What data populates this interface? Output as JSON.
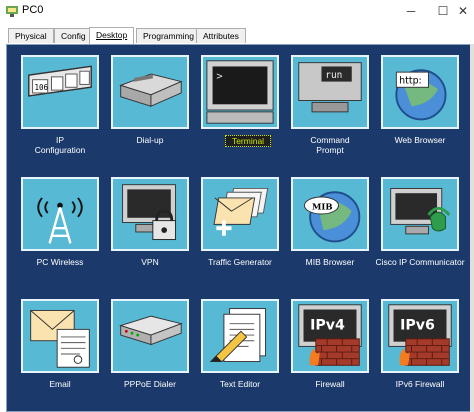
{
  "window": {
    "title": "PC0",
    "minimize": "─",
    "maximize": "☐",
    "close": "✕"
  },
  "tabs": [
    {
      "label": "Physical"
    },
    {
      "label": "Config"
    },
    {
      "label": "Desktop"
    },
    {
      "label": "Programming"
    },
    {
      "label": "Attributes"
    }
  ],
  "active_tab": "Desktop",
  "apps": [
    {
      "label": "IP\nConfiguration",
      "icon": "ip-configuration-icon",
      "badge": "106"
    },
    {
      "label": "Dial-up",
      "icon": "modem-icon"
    },
    {
      "label": "Terminal",
      "icon": "terminal-icon",
      "prompt": ">"
    },
    {
      "label": "Command\nPrompt",
      "icon": "command-prompt-icon",
      "prompt": "run"
    },
    {
      "label": "Web Browser",
      "icon": "web-browser-icon",
      "prompt": "http:"
    },
    {
      "label": "PC Wireless",
      "icon": "wireless-tower-icon"
    },
    {
      "label": "VPN",
      "icon": "vpn-lock-icon"
    },
    {
      "label": "Traffic Generator",
      "icon": "traffic-generator-icon"
    },
    {
      "label": "MIB Browser",
      "icon": "mib-browser-icon",
      "prompt": "MIB"
    },
    {
      "label": "Cisco IP Communicator",
      "icon": "ip-communicator-icon"
    },
    {
      "label": "Email",
      "icon": "email-icon"
    },
    {
      "label": "PPPoE Dialer",
      "icon": "pppoe-dialer-icon"
    },
    {
      "label": "Text Editor",
      "icon": "text-editor-icon"
    },
    {
      "label": "Firewall",
      "icon": "firewall-ipv4-icon",
      "prompt": "IPv4"
    },
    {
      "label": "IPv6 Firewall",
      "icon": "firewall-ipv6-icon",
      "prompt": "IPv6"
    }
  ],
  "selected_app": "Terminal",
  "colors": {
    "desktop_bg": "#1b3a6b",
    "tile_bg": "#57b9d4",
    "selected_label": "#c8e600"
  }
}
